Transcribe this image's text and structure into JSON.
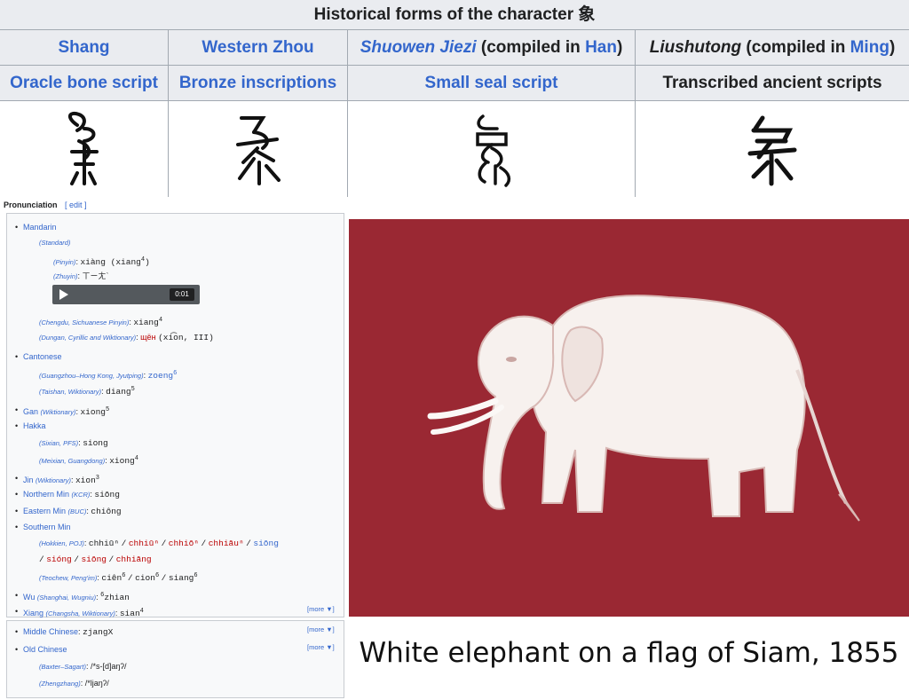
{
  "forms": {
    "title": "Historical forms of the character 象",
    "columns": [
      {
        "period": "Shang",
        "period_parts": [
          "Shang"
        ],
        "script": "Oracle bone script"
      },
      {
        "period": "Western Zhou",
        "period_parts": [
          "Western Zhou"
        ],
        "script": "Bronze inscriptions"
      },
      {
        "period_parts": [
          "Shuowen Jiezi",
          " (compiled in ",
          "Han",
          ")"
        ],
        "script": "Small seal script"
      },
      {
        "period_parts": [
          "Liushutong",
          " (compiled in ",
          "Ming",
          ")"
        ],
        "script": "Transcribed ancient scripts"
      }
    ]
  },
  "pronunciation": {
    "heading": "Pronunciation",
    "edit": "[ edit ]",
    "mandarin": "Mandarin",
    "standard": "(Standard)",
    "pinyin_label": "(Pinyin)",
    "pinyin_value": "xiàng (xiang",
    "pinyin_tone": "4",
    "zhuyin_label": "(Zhuyin)",
    "zhuyin_value": "ㄒㄧㄤˋ",
    "audio_time": "0:01",
    "chengdu_label": "(Chengdu, Sichuanese Pinyin)",
    "chengdu_value": "xiang",
    "chengdu_tone": "4",
    "dungan_label": "(Dungan, Cyrillic and Wiktionary)",
    "dungan_cyrillic": "щён",
    "dungan_rest": "(xi͡on, III)",
    "cantonese": "Cantonese",
    "canton_label": "(Guangzhou–Hong Kong, Jyutping)",
    "canton_value": "zoeng",
    "canton_tone": "6",
    "taishan_label": "(Taishan, Wiktionary)",
    "taishan_value": "diang",
    "taishan_tone": "5",
    "gan": "Gan",
    "gan_label": "(Wiktionary)",
    "gan_value": "xiong",
    "gan_tone": "5",
    "hakka": "Hakka",
    "sixian_label": "(Sixian, PFS)",
    "sixian_value": "siong",
    "meixian_label": "(Meixian, Guangdong)",
    "meixian_value": "xiong",
    "meixian_tone": "4",
    "jin": "Jin",
    "jin_label": "(Wiktionary)",
    "jin_value": "xion",
    "jin_tone": "3",
    "northern_min": "Northern Min",
    "northern_label": "(KCR)",
    "northern_value": "siōng",
    "eastern_min": "Eastern Min",
    "eastern_label": "(BUC)",
    "eastern_value": "chiông",
    "southern_min": "Southern Min",
    "hokkien_label": "(Hokkien, POJ)",
    "hokkien_1": "chhiūⁿ",
    "hokkien_2": "chhiūⁿ",
    "hokkien_3": "chhiōⁿ",
    "hokkien_4": "chhiāuⁿ",
    "hokkien_5": "siōng",
    "hokkien_6": "sióng",
    "hokkien_7": "siōng",
    "hokkien_8": "chhiāng",
    "teochew_label": "(Teochew, Peng'im)",
    "teochew_1": "ciên",
    "teochew_1_tone": "6",
    "teochew_2": "cion",
    "teochew_2_tone": "6",
    "teochew_3": "siang",
    "teochew_3_tone": "6",
    "wu": "Wu",
    "wu_label": "(Shanghai, Wugniu)",
    "wu_tone": "6",
    "wu_value": "zhian",
    "xiang": "Xiang",
    "xiang_label": "(Changsha, Wiktionary)",
    "xiang_value": "sian",
    "xiang_tone": "4",
    "more": "[more ▼]",
    "middle_chinese": "Middle Chinese",
    "middle_value": "zjangX",
    "old_chinese": "Old Chinese",
    "baxter_label": "(Baxter–Sagart)",
    "baxter_value": "/*s-[d]aŋʔ/",
    "zhengzhang_label": "(Zhengzhang)",
    "zhengzhang_value": "/*ljaŋʔ/"
  },
  "figure": {
    "caption": "White elephant on a flag of Siam, 1855",
    "flag_color": "#9a2833"
  }
}
